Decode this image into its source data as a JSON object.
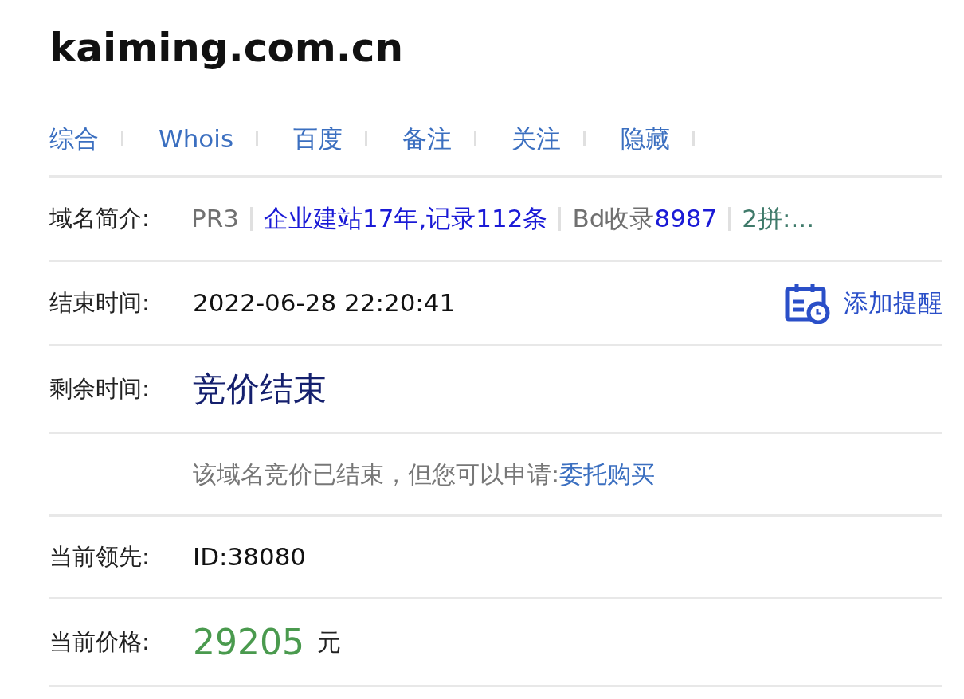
{
  "title": "kaiming.com.cn",
  "links": [
    "综合",
    "Whois",
    "百度",
    "备注",
    "关注",
    "隐藏"
  ],
  "intro": {
    "label": "域名简介:",
    "segments": [
      {
        "parts": [
          {
            "text": "PR3",
            "color": "#707070"
          }
        ]
      },
      {
        "parts": [
          {
            "text": "企业建站17年,记录112条",
            "color": "#1a1ad6"
          }
        ]
      },
      {
        "parts": [
          {
            "text": "Bd收录",
            "color": "#707070"
          },
          {
            "text": "8987",
            "color": "#1a1ad6"
          }
        ]
      },
      {
        "parts": [
          {
            "text": "2拼:...",
            "color": "#3f7a6a"
          }
        ]
      }
    ]
  },
  "rows": [
    {
      "kind": "time",
      "label": "结束时间:",
      "value": "2022-06-28 22:20:41",
      "action": "添加提醒"
    },
    {
      "kind": "status",
      "label": "剩余时间:",
      "value": "竞价结束"
    },
    {
      "kind": "note",
      "text": "该域名竞价已结束，但您可以申请:",
      "link": "委托购买"
    },
    {
      "kind": "text",
      "label": "当前领先:",
      "value": "ID:38080"
    },
    {
      "kind": "price",
      "label": "当前价格:",
      "value": "29205",
      "unit": "元"
    }
  ]
}
